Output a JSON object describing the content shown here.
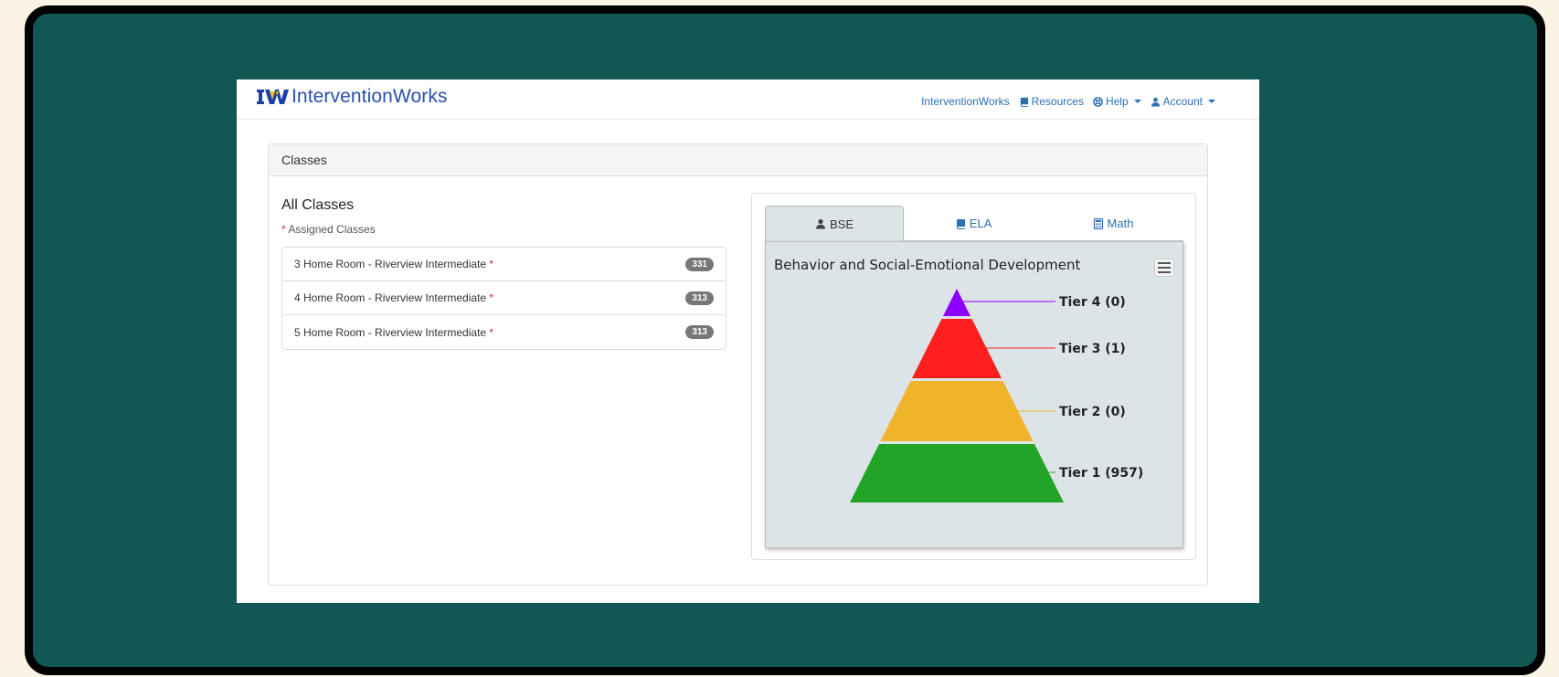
{
  "brand": {
    "name": "InterventionWorks",
    "color": "#2a4fb0"
  },
  "nav": {
    "items": [
      {
        "label": "InterventionWorks",
        "icon": "none"
      },
      {
        "label": "Resources",
        "icon": "book-icon"
      },
      {
        "label": "Help",
        "icon": "lifebuoy-icon",
        "dropdown": true
      },
      {
        "label": "Account",
        "icon": "user-icon",
        "dropdown": true
      }
    ]
  },
  "panel": {
    "heading": "Classes"
  },
  "classes": {
    "title": "All Classes",
    "assigned_marker": "*",
    "assigned_note": "Assigned Classes",
    "items": [
      {
        "name": "3 Home Room - Riverview Intermediate",
        "marker": "*",
        "count": "331"
      },
      {
        "name": "4 Home Room - Riverview Intermediate",
        "marker": "*",
        "count": "313"
      },
      {
        "name": "5 Home Room - Riverview Intermediate",
        "marker": "*",
        "count": "313"
      }
    ]
  },
  "tabs": [
    {
      "label": "BSE",
      "icon": "user-icon",
      "active": true
    },
    {
      "label": "ELA",
      "icon": "book-icon",
      "active": false
    },
    {
      "label": "Math",
      "icon": "calculator-icon",
      "active": false
    }
  ],
  "chart_data": {
    "type": "pyramid",
    "title": "Behavior and Social-Emotional Development",
    "tiers": [
      {
        "name": "Tier 4",
        "value": 0,
        "label": "Tier 4 (0)",
        "color": "#8b00ff"
      },
      {
        "name": "Tier 3",
        "value": 1,
        "label": "Tier 3 (1)",
        "color": "#ff1f1f"
      },
      {
        "name": "Tier 2",
        "value": 0,
        "label": "Tier 2 (0)",
        "color": "#f0b429"
      },
      {
        "name": "Tier 1",
        "value": 957,
        "label": "Tier 1 (957)",
        "color": "#22a527"
      }
    ],
    "legend": "none"
  }
}
